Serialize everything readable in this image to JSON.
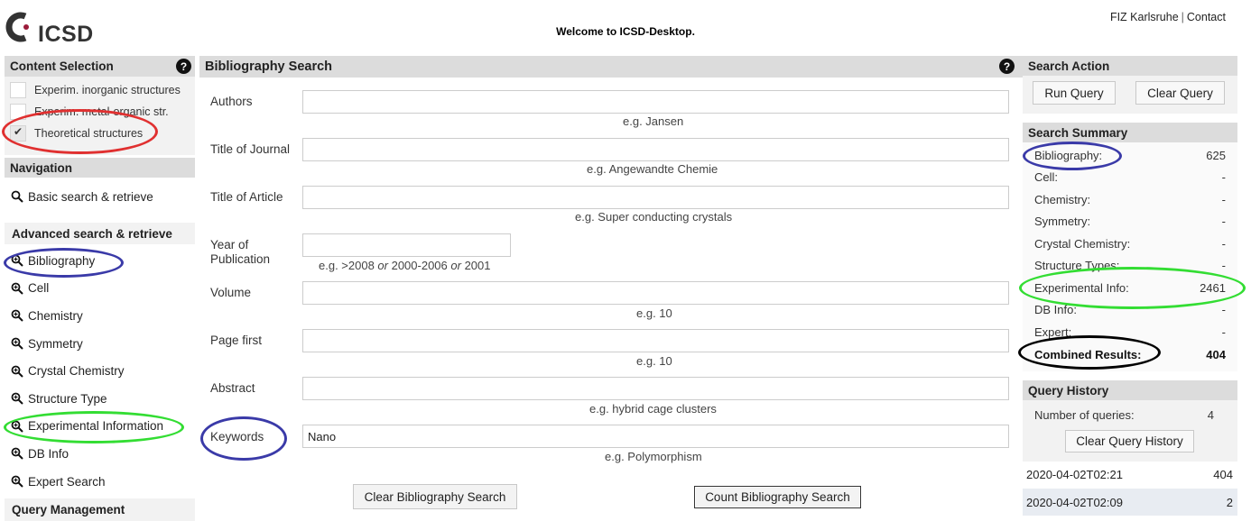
{
  "header": {
    "logo_text": "ICSD",
    "welcome": "Welcome to ICSD-Desktop.",
    "link_fiz": "FIZ Karlsruhe",
    "link_sep": "|",
    "link_contact": "Contact"
  },
  "content_selection": {
    "title": "Content Selection",
    "items": [
      {
        "label": "Experim. inorganic structures",
        "checked": false
      },
      {
        "label": "Experim. metal-organic str.",
        "checked": false
      },
      {
        "label": "Theoretical structures",
        "checked": true
      }
    ]
  },
  "navigation": {
    "title": "Navigation",
    "basic": "Basic search & retrieve",
    "advanced_title": "Advanced search & retrieve",
    "advanced_items": [
      "Bibliography",
      "Cell",
      "Chemistry",
      "Symmetry",
      "Crystal Chemistry",
      "Structure Type",
      "Experimental Information",
      "DB Info",
      "Expert Search"
    ],
    "query_management": "Query Management"
  },
  "bibliography": {
    "title": "Bibliography Search",
    "fields": [
      {
        "label": "Authors",
        "value": "",
        "hint": "e.g. Jansen"
      },
      {
        "label": "Title of Journal",
        "value": "",
        "hint": "e.g. Angewandte Chemie"
      },
      {
        "label": "Title of Article",
        "value": "",
        "hint": "e.g. Super conducting crystals"
      },
      {
        "label_line1": "Year of",
        "label_line2": "Publication",
        "value": "",
        "hint_a": "e.g. >2008 ",
        "hint_or1": "or",
        "hint_b": " 2000-2006 ",
        "hint_or2": "or",
        "hint_c": " 2001"
      },
      {
        "label": "Volume",
        "value": "",
        "hint": "e.g. 10"
      },
      {
        "label": "Page first",
        "value": "",
        "hint": "e.g. 10"
      },
      {
        "label": "Abstract",
        "value": "",
        "hint": "e.g. hybrid cage clusters"
      },
      {
        "label": "Keywords",
        "value": "Nano",
        "hint": "e.g. Polymorphism"
      }
    ],
    "clear_button": "Clear Bibliography Search",
    "count_button": "Count Bibliography Search"
  },
  "search_action": {
    "title": "Search Action",
    "run": "Run Query",
    "clear": "Clear Query"
  },
  "search_summary": {
    "title": "Search Summary",
    "rows": [
      {
        "label": "Bibliography:",
        "value": "625"
      },
      {
        "label": "Cell:",
        "value": "-"
      },
      {
        "label": "Chemistry:",
        "value": "-"
      },
      {
        "label": "Symmetry:",
        "value": "-"
      },
      {
        "label": "Crystal Chemistry:",
        "value": "-"
      },
      {
        "label": "Structure Types:",
        "value": "-"
      },
      {
        "label": "Experimental Info:",
        "value": "2461"
      },
      {
        "label": "DB Info:",
        "value": "-"
      },
      {
        "label": "Expert:",
        "value": "-"
      },
      {
        "label": "Combined Results:",
        "value": "404"
      }
    ]
  },
  "query_history": {
    "title": "Query History",
    "count_label": "Number of queries:",
    "count_value": "4",
    "clear_button": "Clear Query History",
    "entries": [
      {
        "time": "2020-04-02T02:21",
        "count": "404"
      },
      {
        "time": "2020-04-02T02:09",
        "count": "2"
      }
    ]
  },
  "colors": {
    "panel_header": "#dcdcdc",
    "annotation_red": "#e03030",
    "annotation_blue": "#3a3aa8",
    "annotation_green": "#33dd33",
    "annotation_black": "#000000"
  }
}
